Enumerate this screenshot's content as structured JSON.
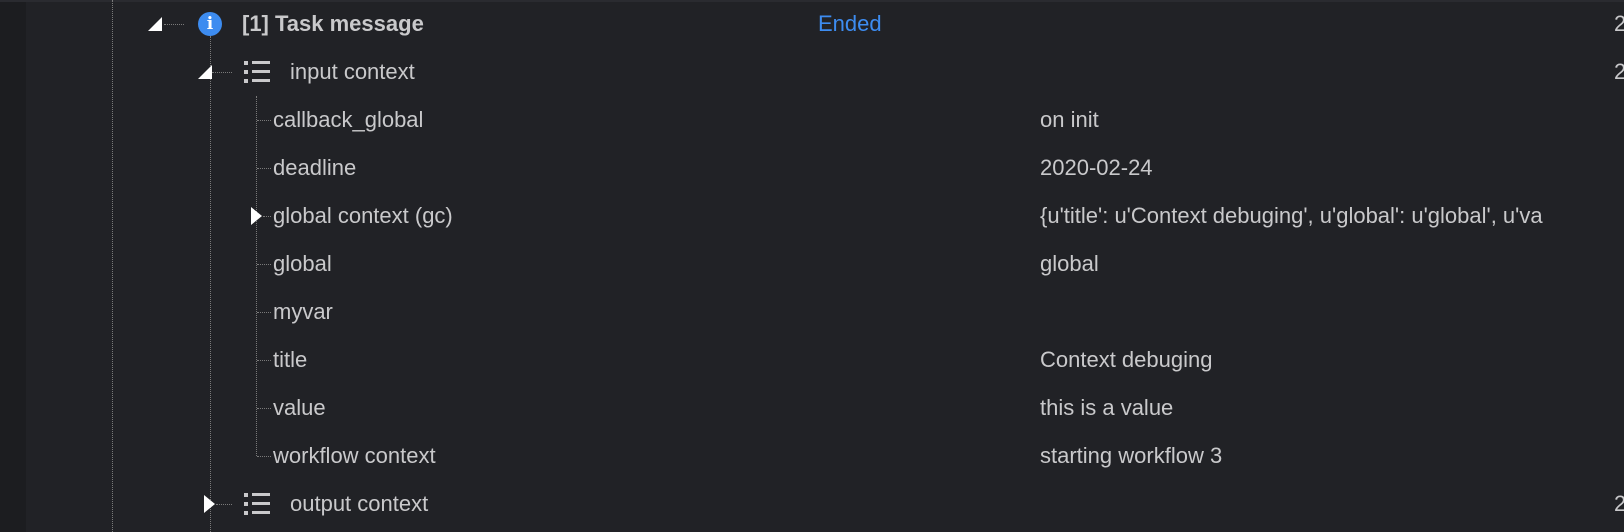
{
  "task": {
    "label": "[1] Task message",
    "status": "Ended",
    "icon": "info-icon",
    "status_color": "#3d8cf0"
  },
  "input_context": {
    "label": "input context",
    "icon": "list-icon",
    "items": [
      {
        "key": "callback_global",
        "value": "on init"
      },
      {
        "key": "deadline",
        "value": "2020-02-24"
      },
      {
        "key": "global context (gc)",
        "value": "{u'title': u'Context debuging', u'global': u'global', u'va"
      },
      {
        "key": "global",
        "value": "global"
      },
      {
        "key": "myvar",
        "value": ""
      },
      {
        "key": "title",
        "value": "Context debuging"
      },
      {
        "key": "value",
        "value": "this is a value"
      },
      {
        "key": "workflow context",
        "value": "starting workflow 3"
      }
    ]
  },
  "output_context": {
    "label": "output context",
    "icon": "list-icon"
  },
  "edge_glyph": "2"
}
